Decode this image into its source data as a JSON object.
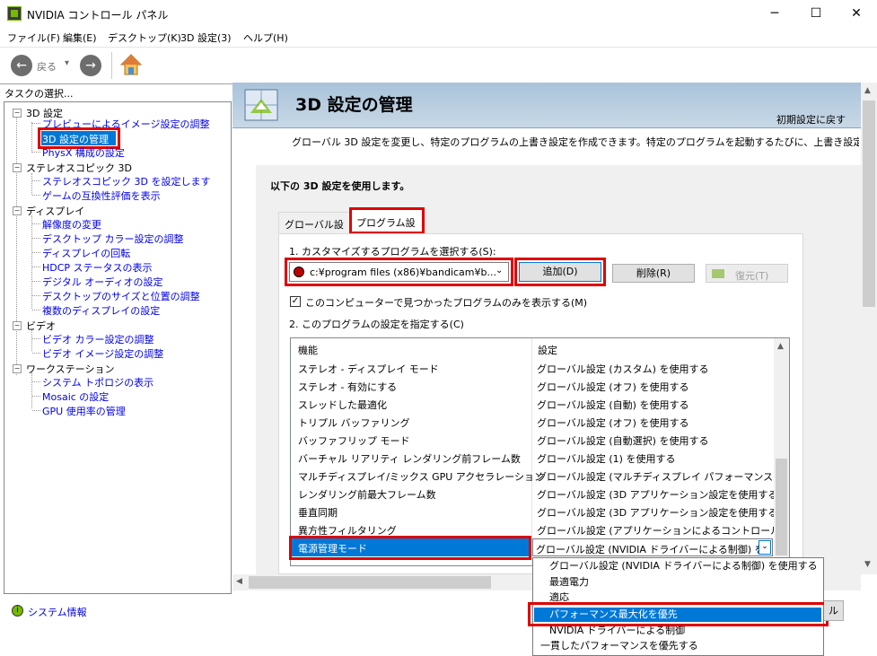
{
  "window": {
    "title": "NVIDIA コントロール パネル",
    "minimize": "─",
    "maximize": "☐",
    "close": "✕"
  },
  "menu": [
    "ファイル(F)",
    "編集(E)",
    "デスクトップ(K)",
    "3D 設定(3)",
    "ヘルプ(H)"
  ],
  "toolbar": {
    "back_label": "戻る",
    "back_arrow": "▾"
  },
  "tasks_label": "タスクの選択...",
  "tree": {
    "cat_3d": "3D 設定",
    "item_preview": "プレビューによるイメージ設定の調整",
    "item_manage3d": "3D 設定の管理",
    "item_physx": "PhysX 構成の設定",
    "cat_stereo": "ステレオスコピック 3D",
    "item_stereo_set": "ステレオスコピック 3D を設定します",
    "item_game_compat": "ゲームの互換性評価を表示",
    "cat_display": "ディスプレイ",
    "item_resolution": "解像度の変更",
    "item_color": "デスクトップ カラー設定の調整",
    "item_rotate": "ディスプレイの回転",
    "item_hdcp": "HDCP ステータスの表示",
    "item_audio": "デジタル オーディオの設定",
    "item_size": "デスクトップのサイズと位置の調整",
    "item_multi": "複数のディスプレイの設定",
    "cat_video": "ビデオ",
    "item_video_color": "ビデオ カラー設定の調整",
    "item_video_image": "ビデオ イメージ設定の調整",
    "cat_workstation": "ワークステーション",
    "item_topology": "システム トポロジの表示",
    "item_mosaic": "Mosaic の設定",
    "item_gpu_usage": "GPU 使用率の管理"
  },
  "system_info": "システム情報",
  "page": {
    "title": "3D 設定の管理",
    "restore_defaults": "初期設定に戻す",
    "description": "グローバル 3D 設定を変更し、特定のプログラムの上書き設定を作成できます。特定のプログラムを起動するたびに、上書き設定が自動的",
    "use_settings_label": "以下の 3D 設定を使用します。",
    "tabs": [
      "グローバル設定",
      "プログラム設定"
    ],
    "step1_label": "1. カスタマイズするプログラムを選択する(S):",
    "program_value": "c:¥program files (x86)¥bandicam¥b...",
    "add_button": "追加(D)",
    "remove_button": "削除(R)",
    "restore_button": "復元(T)",
    "only_found_checkbox": "このコンピューターで見つかったプログラムのみを表示する(M)",
    "step2_label": "2. このプログラムの設定を指定する(C)",
    "col_feature": "機能",
    "col_setting": "設定"
  },
  "settings_rows": [
    {
      "feature": "ステレオ - ディスプレイ モード",
      "setting": "グローバル設定 (カスタム) を使用する"
    },
    {
      "feature": "ステレオ - 有効にする",
      "setting": "グローバル設定 (オフ) を使用する"
    },
    {
      "feature": "スレッドした最適化",
      "setting": "グローバル設定 (自動) を使用する"
    },
    {
      "feature": "トリプル バッファリング",
      "setting": "グローバル設定 (オフ) を使用する"
    },
    {
      "feature": "バッファフリップ モード",
      "setting": "グローバル設定 (自動選択) を使用する"
    },
    {
      "feature": "バーチャル リアリティ レンダリング前フレーム数",
      "setting": "グローバル設定 (1) を使用する"
    },
    {
      "feature": "マルチディスプレイ/ミックス GPU アクセラレーション",
      "setting": "グローバル設定 (マルチディスプレイ パフォーマンス モー..."
    },
    {
      "feature": "レンダリング前最大フレーム数",
      "setting": "グローバル設定 (3D アプリケーション設定を使用する) ..."
    },
    {
      "feature": "垂直同期",
      "setting": "グローバル設定 (3D アプリケーション設定を使用する) ..."
    },
    {
      "feature": "異方性フィルタリング",
      "setting": "グローバル設定 (アプリケーションによるコントロール) を..."
    }
  ],
  "selected_row": {
    "feature": "電源管理モード",
    "setting": "グローバル設定 (NVIDIA ドライバーによる制御) を使用"
  },
  "dropdown_options": [
    "グローバル設定 (NVIDIA ドライバーによる制御) を使用する",
    "最適電力",
    "適応",
    "パフォーマンス最大化を優先",
    "NVIDIA ドライバーによる制御",
    "一貫したパフォーマンスを優先する"
  ],
  "partial_button_text": "ル"
}
